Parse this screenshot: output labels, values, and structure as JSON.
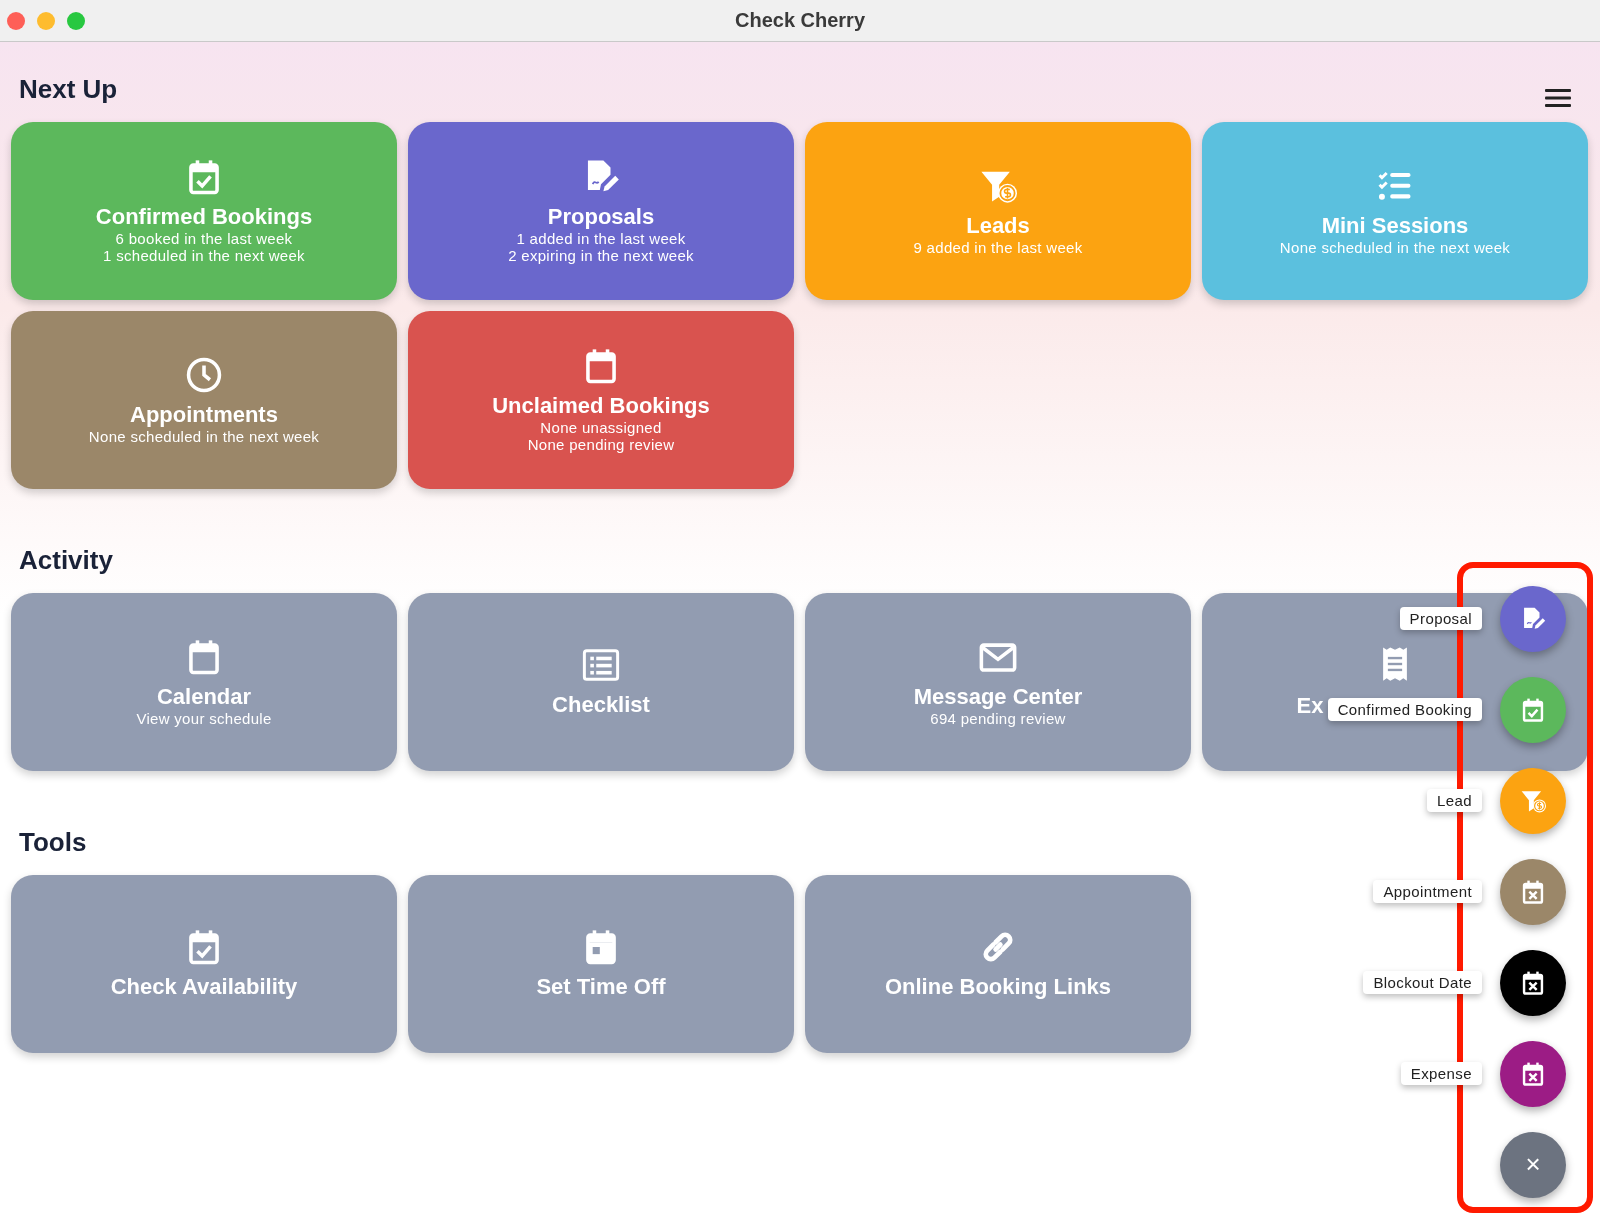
{
  "window": {
    "title": "Check Cherry"
  },
  "sections": [
    {
      "title": "Next Up",
      "cards": [
        {
          "title": "Confirmed Bookings",
          "lines": [
            "6 booked in the last week",
            "1 scheduled in the next week"
          ],
          "color": "#5cb85c"
        },
        {
          "title": "Proposals",
          "lines": [
            "1 added in the last week",
            "2 expiring in the next week"
          ],
          "color": "#6a67cc"
        },
        {
          "title": "Leads",
          "lines": [
            "9 added in the last week"
          ],
          "color": "#fca311"
        },
        {
          "title": "Mini Sessions",
          "lines": [
            "None scheduled in the next week"
          ],
          "color": "#5bc0de"
        },
        {
          "title": "Appointments",
          "lines": [
            "None scheduled in the next week"
          ],
          "color": "#9b8769"
        },
        {
          "title": "Unclaimed Bookings",
          "lines": [
            "None unassigned",
            "None pending review"
          ],
          "color": "#d9534f"
        }
      ]
    },
    {
      "title": "Activity",
      "cards": [
        {
          "title": "Calendar",
          "lines": [
            "View your schedule"
          ]
        },
        {
          "title": "Checklist"
        },
        {
          "title": "Message Center",
          "lines": [
            "694 pending review"
          ]
        },
        {
          "title": "Ex"
        }
      ]
    },
    {
      "title": "Tools",
      "cards": [
        {
          "title": "Check Availability"
        },
        {
          "title": "Set Time Off"
        },
        {
          "title": "Online Booking Links"
        }
      ]
    }
  ],
  "fab": {
    "actions": [
      {
        "label": "Proposal",
        "color": "#6a67cc"
      },
      {
        "label": "Confirmed Booking",
        "color": "#5cb85c"
      },
      {
        "label": "Lead",
        "color": "#fca311"
      },
      {
        "label": "Appointment",
        "color": "#9b8769"
      },
      {
        "label": "Blockout Date",
        "color": "#000000"
      },
      {
        "label": "Expense",
        "color": "#9c1c85"
      }
    ],
    "close": "×"
  }
}
